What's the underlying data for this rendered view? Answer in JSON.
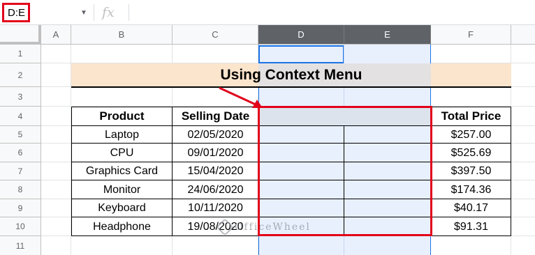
{
  "formula_bar": {
    "name_box": "D:E",
    "fx_icon": "fx-icon"
  },
  "columns": [
    "A",
    "B",
    "C",
    "D",
    "E",
    "F"
  ],
  "rows": [
    "1",
    "2",
    "3",
    "4",
    "5",
    "6",
    "7",
    "8",
    "9",
    "10",
    "11"
  ],
  "selected_columns": [
    "D",
    "E"
  ],
  "title": "Using Context Menu",
  "table": {
    "headers": [
      "Product",
      "Selling Date",
      "",
      "",
      "Total Price"
    ],
    "rows": [
      [
        "Laptop",
        "02/05/2020",
        "$257.00"
      ],
      [
        "CPU",
        "09/01/2020",
        "$525.69"
      ],
      [
        "Graphics Card",
        "15/04/2020",
        "$397.50"
      ],
      [
        "Monitor",
        "24/06/2020",
        "$174.36"
      ],
      [
        "Keyboard",
        "10/11/2020",
        "$40.17"
      ],
      [
        "Headphone",
        "19/08/2020",
        "$91.31"
      ]
    ]
  },
  "watermark": "OfficeWheel",
  "colors": {
    "selection_fill": "#e8f0fe",
    "selection_border": "#1a73e8",
    "title_fill": "#fce5cd",
    "annotation_red": "#e2001a"
  }
}
